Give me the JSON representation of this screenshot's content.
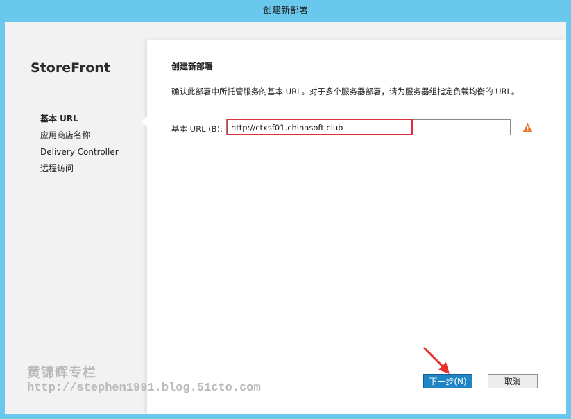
{
  "window": {
    "title": "创建新部署"
  },
  "sidebar": {
    "brand": "StoreFront",
    "items": [
      {
        "label": "基本 URL",
        "active": true
      },
      {
        "label": "应用商店名称",
        "active": false
      },
      {
        "label": "Delivery Controller",
        "active": false
      },
      {
        "label": "远程访问",
        "active": false
      }
    ]
  },
  "main": {
    "section_title": "创建新部署",
    "description": "确认此部署中所托管服务的基本 URL。对于多个服务器部署，请为服务器组指定负载均衡的 URL。",
    "base_url_label": "基本 URL (B):",
    "base_url_value": "http://ctxsf01.chinasoft.club",
    "warning_icon": "warning-triangle-icon",
    "warning_color": "#e8742b"
  },
  "watermark": {
    "author": "黄锦辉专栏",
    "url": "http://stephen1991.blog.51cto.com"
  },
  "buttons": {
    "next_label": "下一步(N)",
    "cancel_label": "取消"
  },
  "annotations": {
    "highlight_color": "#d9323c",
    "arrow_color": "#e8312f"
  }
}
